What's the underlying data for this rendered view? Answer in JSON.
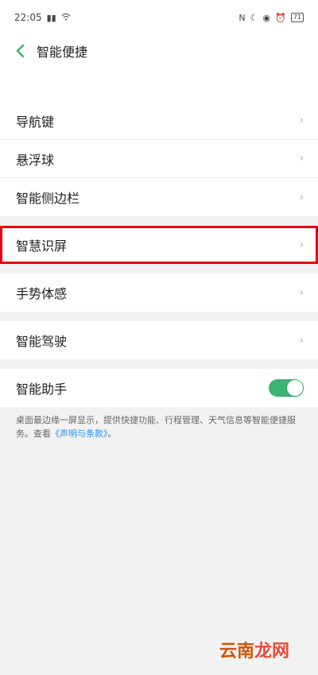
{
  "status_bar": {
    "time": "22:05",
    "battery": "71"
  },
  "header": {
    "title": "智能便捷"
  },
  "groups": [
    [
      {
        "label": "导航键"
      },
      {
        "label": "悬浮球"
      },
      {
        "label": "智能侧边栏"
      }
    ],
    [
      {
        "label": "智慧识屏"
      }
    ],
    [
      {
        "label": "手势体感"
      }
    ],
    [
      {
        "label": "智能驾驶"
      }
    ],
    [
      {
        "label": "智能助手",
        "toggle": true
      }
    ]
  ],
  "note": {
    "text": "桌面最边缘一屏显示，提供快捷功能、行程管理、天气信息等智能便捷服务。查看",
    "link": "《声明与条款》",
    "suffix": "。"
  },
  "watermark": {
    "part1": "云南",
    "part2": "龙网"
  },
  "colors": {
    "toggle_on": "#3cb371",
    "highlight": "#e60012",
    "link": "#1e90ff",
    "accent": "#3cb371"
  }
}
